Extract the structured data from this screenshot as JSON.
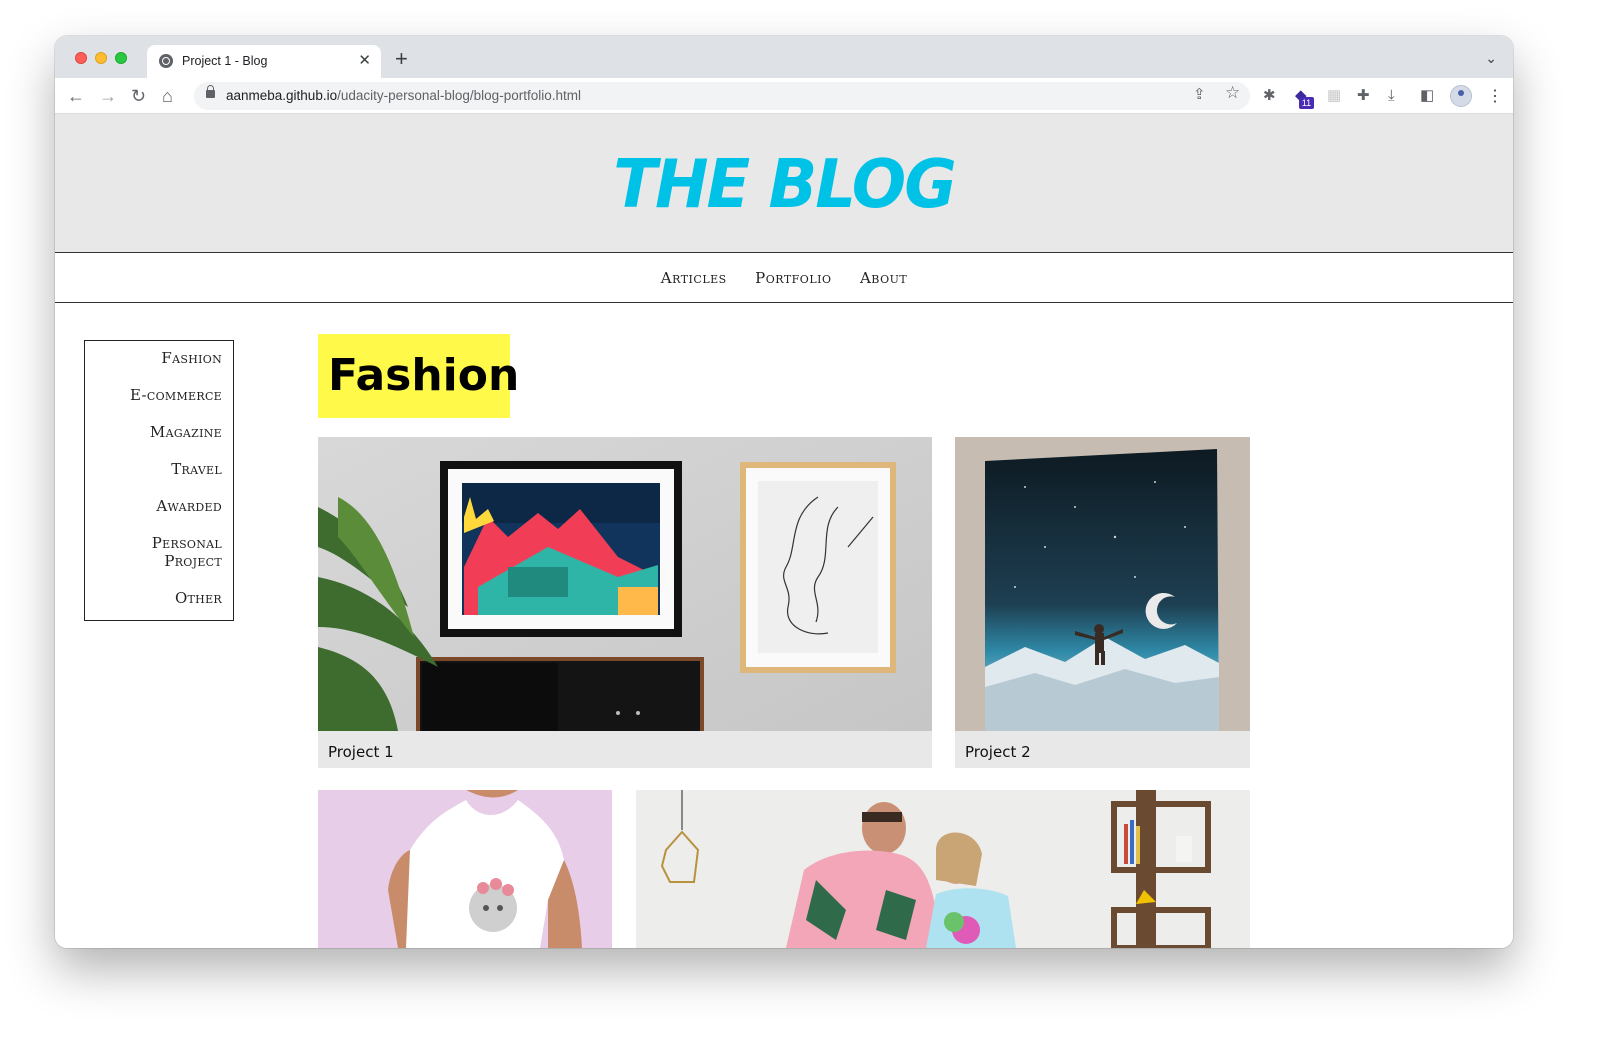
{
  "browser": {
    "tab_title": "Project 1 - Blog",
    "url_host": "aanmeba.github.io",
    "url_path": "/udacity-personal-blog/blog-portfolio.html",
    "extension_badge": "11"
  },
  "site": {
    "logo": "THE BLOG",
    "accent_color": "#00c2e6",
    "nav": [
      "Articles",
      "Portfolio",
      "About"
    ]
  },
  "sidebar": {
    "items": [
      "Fashion",
      "E-commerce",
      "Magazine",
      "Travel",
      "Awarded",
      "Personal Project",
      "Other"
    ]
  },
  "main": {
    "section_title": "Fashion",
    "highlight_color": "#fff94a",
    "projects": [
      {
        "caption": "Project 1"
      },
      {
        "caption": "Project 2"
      }
    ]
  },
  "icons": {
    "back": "arrow-left-icon",
    "forward": "arrow-right-icon",
    "reload": "reload-icon",
    "home": "home-icon",
    "share": "share-icon",
    "bookmark": "star-icon",
    "extensions": "puzzle-icon",
    "download": "download-icon"
  }
}
